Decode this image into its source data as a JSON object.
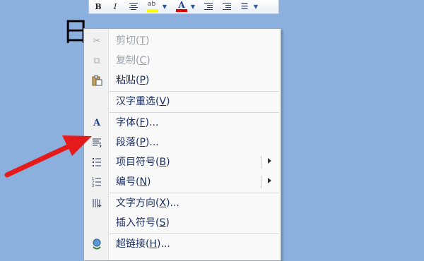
{
  "toolbar": {
    "bold": "B",
    "italic": "I",
    "font_color": "A",
    "highlight_text": "ab",
    "highlight_color": "#ffff00",
    "font_color_color": "#e00000"
  },
  "document": {
    "text": "日"
  },
  "menu": {
    "items": [
      {
        "text": "剪切(",
        "key": "T",
        "end": ")",
        "icon": "scissors-icon",
        "disabled": true
      },
      {
        "text": "复制(",
        "key": "C",
        "end": ")",
        "icon": "copy-icon",
        "disabled": true
      },
      {
        "text": "粘贴(",
        "key": "P",
        "end": ")",
        "icon": "paste-icon",
        "disabled": false
      },
      {
        "text": "汉字重选(",
        "key": "V",
        "end": ")",
        "icon": "",
        "disabled": false
      },
      {
        "text": "字体(",
        "key": "F",
        "end": ")...",
        "icon": "font-icon",
        "disabled": false
      },
      {
        "text": "段落(",
        "key": "P",
        "end": ")...",
        "icon": "paragraph-icon",
        "disabled": false
      },
      {
        "text": "项目符号(",
        "key": "B",
        "end": ")",
        "icon": "bullets-icon",
        "disabled": false,
        "submenu": true
      },
      {
        "text": "编号(",
        "key": "N",
        "end": ")",
        "icon": "numbering-icon",
        "disabled": false,
        "submenu": true
      },
      {
        "text": "文字方向(",
        "key": "X",
        "end": ")...",
        "icon": "text-direction-icon",
        "disabled": false
      },
      {
        "text": "插入符号(",
        "key": "S",
        "end": ")",
        "icon": "",
        "disabled": false
      },
      {
        "text": "超链接(",
        "key": "H",
        "end": ")...",
        "icon": "hyperlink-icon",
        "disabled": false
      }
    ]
  },
  "annotation": {
    "arrow_color": "#e51b1b",
    "target": "paragraph-icon"
  }
}
